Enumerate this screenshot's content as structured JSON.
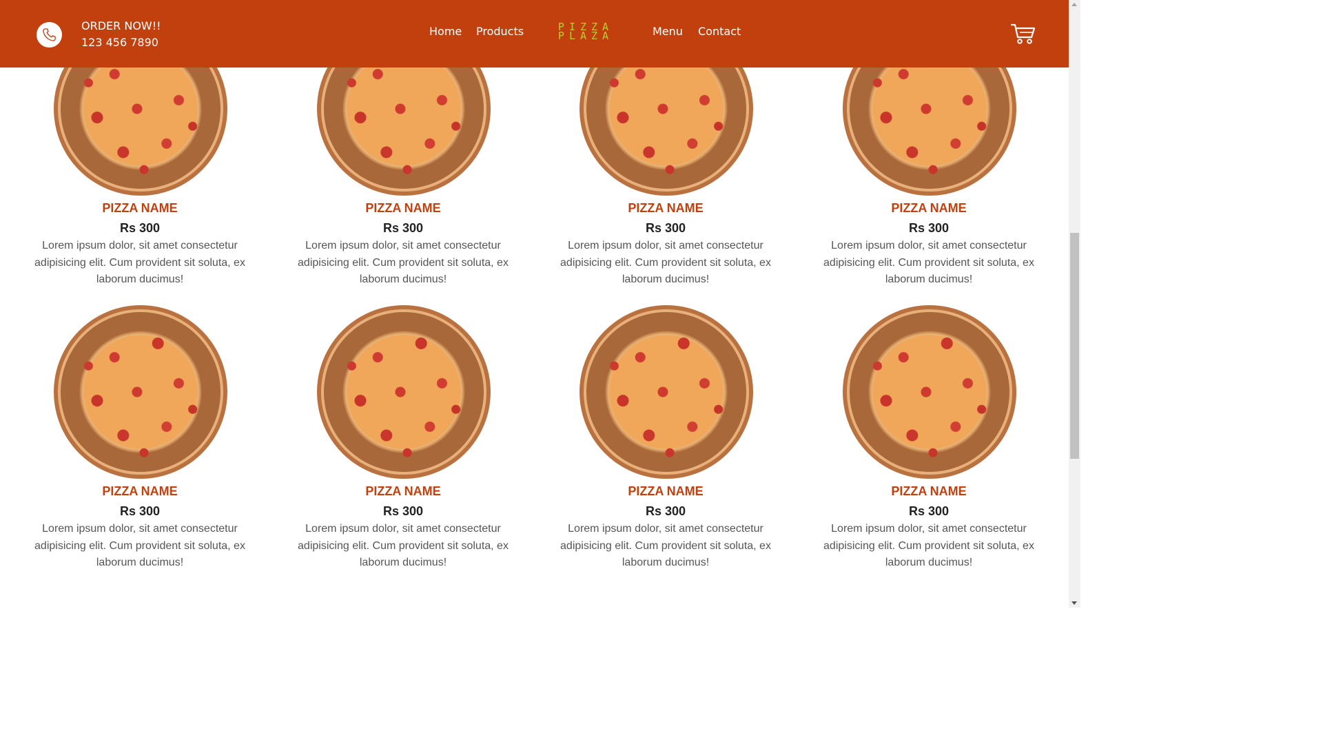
{
  "header": {
    "order_label": "ORDER NOW!!",
    "phone_number": "123 456 7890",
    "nav": {
      "home": "Home",
      "products": "Products",
      "menu": "Menu",
      "contact": "Contact"
    },
    "logo_line1": "PIZZA",
    "logo_line2": "PLAZA",
    "brand_color": "#c1400d",
    "logo_color": "#b5d12b"
  },
  "products": [
    {
      "name": "PIZZA NAME",
      "price": "Rs 300",
      "description": "Lorem ipsum dolor, sit amet consectetur adipisicing elit. Cum provident sit soluta, ex laborum ducimus!"
    },
    {
      "name": "PIZZA NAME",
      "price": "Rs 300",
      "description": "Lorem ipsum dolor, sit amet consectetur adipisicing elit. Cum provident sit soluta, ex laborum ducimus!"
    },
    {
      "name": "PIZZA NAME",
      "price": "Rs 300",
      "description": "Lorem ipsum dolor, sit amet consectetur adipisicing elit. Cum provident sit soluta, ex laborum ducimus!"
    },
    {
      "name": "PIZZA NAME",
      "price": "Rs 300",
      "description": "Lorem ipsum dolor, sit amet consectetur adipisicing elit. Cum provident sit soluta, ex laborum ducimus!"
    },
    {
      "name": "PIZZA NAME",
      "price": "Rs 300",
      "description": "Lorem ipsum dolor, sit amet consectetur adipisicing elit. Cum provident sit soluta, ex laborum ducimus!"
    },
    {
      "name": "PIZZA NAME",
      "price": "Rs 300",
      "description": "Lorem ipsum dolor, sit amet consectetur adipisicing elit. Cum provident sit soluta, ex laborum ducimus!"
    },
    {
      "name": "PIZZA NAME",
      "price": "Rs 300",
      "description": "Lorem ipsum dolor, sit amet consectetur adipisicing elit. Cum provident sit soluta, ex laborum ducimus!"
    },
    {
      "name": "PIZZA NAME",
      "price": "Rs 300",
      "description": "Lorem ipsum dolor, sit amet consectetur adipisicing elit. Cum provident sit soluta, ex laborum ducimus!"
    }
  ]
}
